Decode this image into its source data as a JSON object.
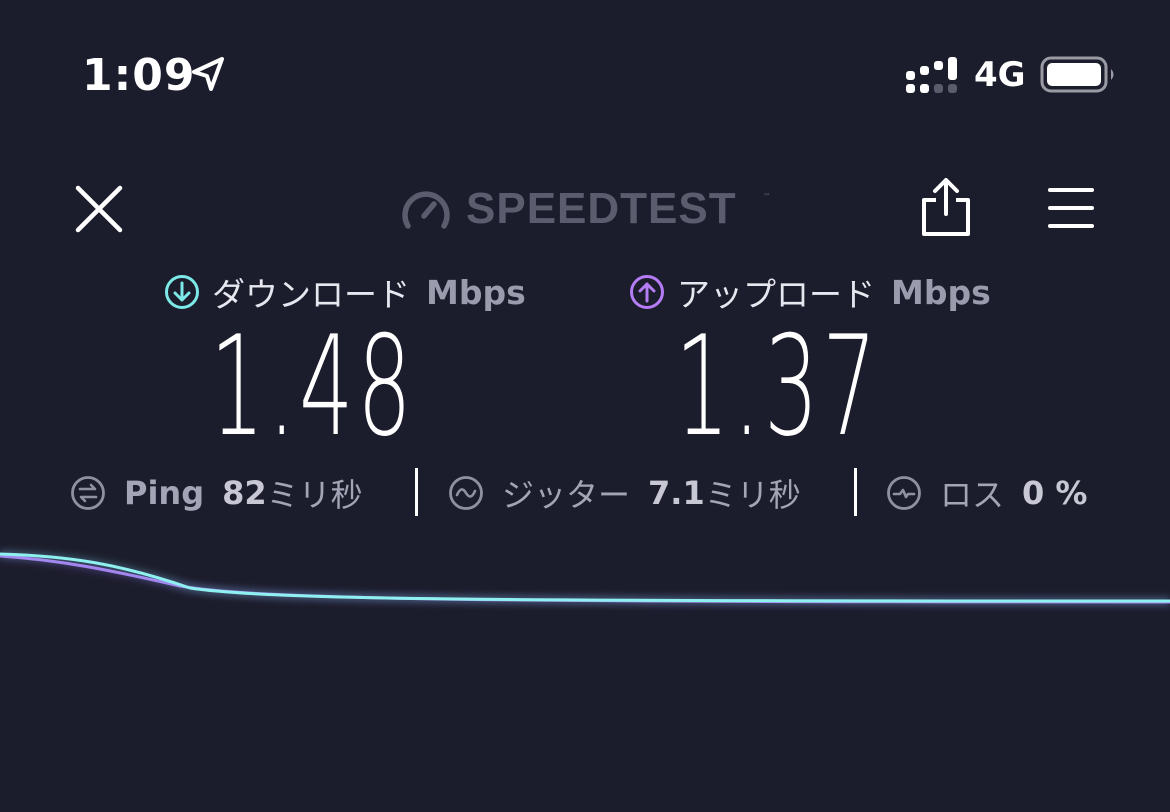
{
  "status_bar": {
    "time": "1:09",
    "network": "4G",
    "location_icon": "location-arrow-icon",
    "signal_icon": "signal-bars-icon",
    "battery_icon": "battery-icon"
  },
  "nav": {
    "brand": "SPEEDTEST",
    "brand_mark": "™",
    "close_icon": "close-icon",
    "share_icon": "share-icon",
    "menu_icon": "menu-icon"
  },
  "download": {
    "label": "ダウンロード",
    "unit": "Mbps",
    "value": "1.48",
    "icon": "download-arrow-icon",
    "color": "#7ce8e8"
  },
  "upload": {
    "label": "アップロード",
    "unit": "Mbps",
    "value": "1.37",
    "icon": "upload-arrow-icon",
    "color": "#b57cf5"
  },
  "stats": {
    "ping": {
      "label": "Ping",
      "value": "82",
      "unit": "ミリ秒",
      "icon": "ping-icon"
    },
    "jitter": {
      "label": "ジッター",
      "value": "7.1",
      "unit": "ミリ秒",
      "icon": "jitter-icon"
    },
    "loss": {
      "label": "ロス",
      "value": "0 %",
      "icon": "packet-loss-icon"
    }
  },
  "colors": {
    "background": "#1c1d2c",
    "download_line": "#8ff0f0",
    "upload_line": "#a77cf0"
  }
}
